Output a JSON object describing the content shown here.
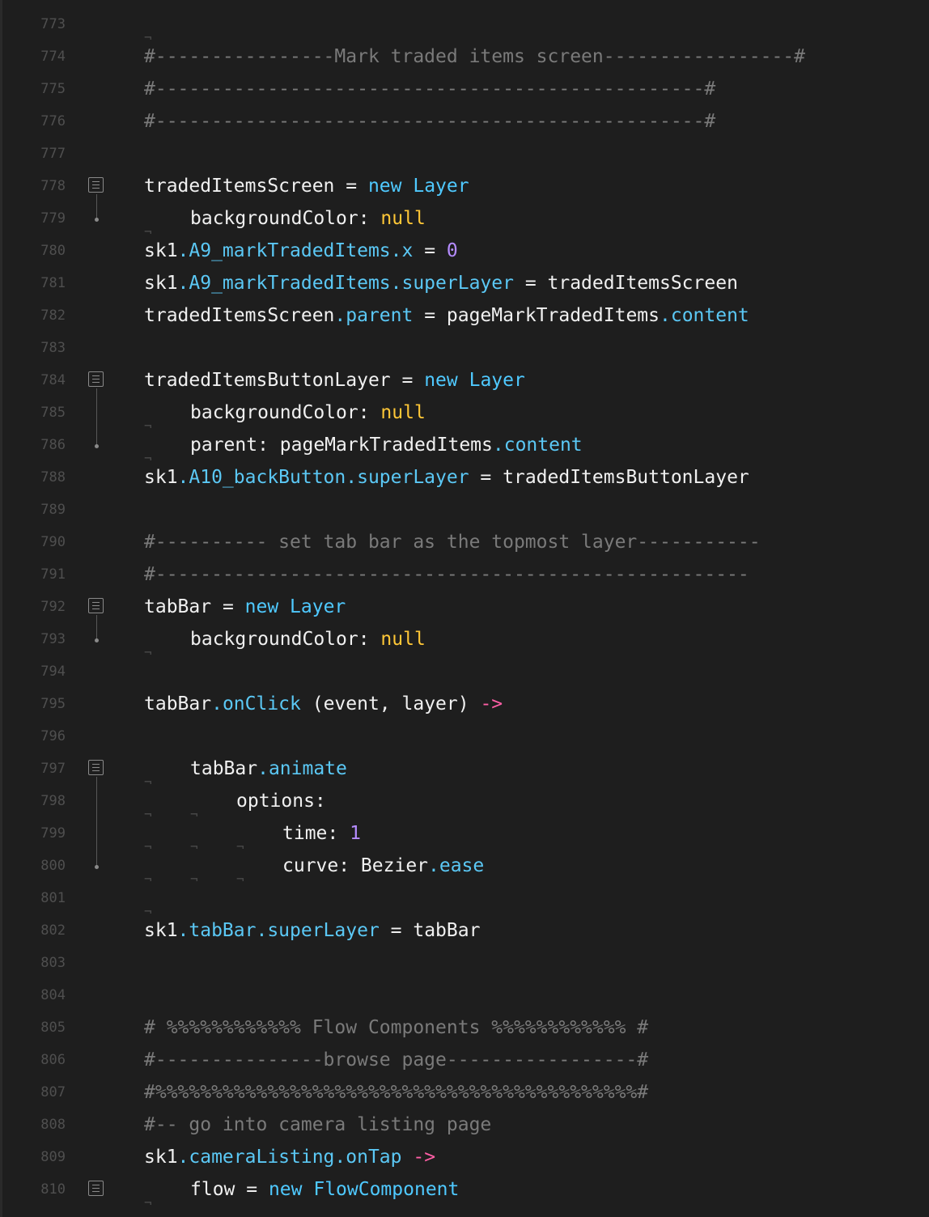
{
  "editor": {
    "lines": [
      {
        "num": "773",
        "indent": 1,
        "tokens": []
      },
      {
        "num": "774",
        "indent": 0,
        "tokens": [
          {
            "c": "comment",
            "t": "#----------------Mark traded items screen-----------------#"
          }
        ]
      },
      {
        "num": "775",
        "indent": 0,
        "tokens": [
          {
            "c": "comment",
            "t": "#-------------------------------------------------#"
          }
        ]
      },
      {
        "num": "776",
        "indent": 0,
        "tokens": [
          {
            "c": "comment",
            "t": "#-------------------------------------------------#"
          }
        ]
      },
      {
        "num": "777",
        "indent": 0,
        "tokens": []
      },
      {
        "num": "778",
        "indent": 0,
        "fold": "start",
        "tokens": [
          {
            "c": "plain",
            "t": "tradedItemsScreen"
          },
          {
            "c": "op",
            "t": " = "
          },
          {
            "c": "kw",
            "t": "new"
          },
          {
            "c": "plain",
            "t": " "
          },
          {
            "c": "class",
            "t": "Layer"
          }
        ]
      },
      {
        "num": "779",
        "indent": 1,
        "fold": "end",
        "tokens": [
          {
            "c": "plain",
            "t": "backgroundColor: "
          },
          {
            "c": "null",
            "t": "null"
          }
        ]
      },
      {
        "num": "780",
        "indent": 0,
        "tokens": [
          {
            "c": "plain",
            "t": "sk1"
          },
          {
            "c": "prop",
            "t": ".A9_markTradedItems.x"
          },
          {
            "c": "op",
            "t": " = "
          },
          {
            "c": "num",
            "t": "0"
          }
        ]
      },
      {
        "num": "781",
        "indent": 0,
        "tokens": [
          {
            "c": "plain",
            "t": "sk1"
          },
          {
            "c": "prop",
            "t": ".A9_markTradedItems.superLayer"
          },
          {
            "c": "op",
            "t": " = "
          },
          {
            "c": "plain",
            "t": "tradedItemsScreen"
          }
        ]
      },
      {
        "num": "782",
        "indent": 0,
        "tokens": [
          {
            "c": "plain",
            "t": "tradedItemsScreen"
          },
          {
            "c": "prop",
            "t": ".parent"
          },
          {
            "c": "op",
            "t": " = "
          },
          {
            "c": "plain",
            "t": "pageMarkTradedItems"
          },
          {
            "c": "prop",
            "t": ".content"
          }
        ]
      },
      {
        "num": "783",
        "indent": 0,
        "tokens": []
      },
      {
        "num": "784",
        "indent": 0,
        "fold": "start",
        "tokens": [
          {
            "c": "plain",
            "t": "tradedItemsButtonLayer"
          },
          {
            "c": "op",
            "t": " = "
          },
          {
            "c": "kw",
            "t": "new"
          },
          {
            "c": "plain",
            "t": " "
          },
          {
            "c": "class",
            "t": "Layer"
          }
        ]
      },
      {
        "num": "785",
        "indent": 1,
        "tokens": [
          {
            "c": "plain",
            "t": "backgroundColor: "
          },
          {
            "c": "null",
            "t": "null"
          }
        ]
      },
      {
        "num": "786",
        "indent": 1,
        "fold": "end",
        "tokens": [
          {
            "c": "plain",
            "t": "parent: pageMarkTradedItems"
          },
          {
            "c": "prop",
            "t": ".content"
          }
        ]
      },
      {
        "num": "788",
        "indent": 0,
        "tokens": [
          {
            "c": "plain",
            "t": "sk1"
          },
          {
            "c": "prop",
            "t": ".A10_backButton.superLayer"
          },
          {
            "c": "op",
            "t": " = "
          },
          {
            "c": "plain",
            "t": "tradedItemsButtonLayer"
          }
        ]
      },
      {
        "num": "789",
        "indent": 0,
        "tokens": []
      },
      {
        "num": "790",
        "indent": 0,
        "tokens": [
          {
            "c": "comment",
            "t": "#---------- set tab bar as the topmost layer-----------"
          }
        ]
      },
      {
        "num": "791",
        "indent": 0,
        "tokens": [
          {
            "c": "comment",
            "t": "#-----------------------------------------------------"
          }
        ]
      },
      {
        "num": "792",
        "indent": 0,
        "fold": "start",
        "tokens": [
          {
            "c": "plain",
            "t": "tabBar"
          },
          {
            "c": "op",
            "t": " = "
          },
          {
            "c": "kw",
            "t": "new"
          },
          {
            "c": "plain",
            "t": " "
          },
          {
            "c": "class",
            "t": "Layer"
          }
        ]
      },
      {
        "num": "793",
        "indent": 1,
        "fold": "end",
        "tokens": [
          {
            "c": "plain",
            "t": "backgroundColor: "
          },
          {
            "c": "null",
            "t": "null"
          }
        ]
      },
      {
        "num": "794",
        "indent": 0,
        "tokens": []
      },
      {
        "num": "795",
        "indent": 0,
        "tokens": [
          {
            "c": "plain",
            "t": "tabBar"
          },
          {
            "c": "prop",
            "t": ".onClick"
          },
          {
            "c": "plain",
            "t": " (event, layer) "
          },
          {
            "c": "arrow",
            "t": "->"
          }
        ]
      },
      {
        "num": "796",
        "indent": 0,
        "tokens": []
      },
      {
        "num": "797",
        "indent": 1,
        "fold": "start",
        "tokens": [
          {
            "c": "plain",
            "t": "tabBar"
          },
          {
            "c": "prop",
            "t": ".animate"
          }
        ]
      },
      {
        "num": "798",
        "indent": 2,
        "tokens": [
          {
            "c": "plain",
            "t": "options:"
          }
        ]
      },
      {
        "num": "799",
        "indent": 3,
        "tokens": [
          {
            "c": "plain",
            "t": "time: "
          },
          {
            "c": "num",
            "t": "1"
          }
        ]
      },
      {
        "num": "800",
        "indent": 3,
        "fold": "end",
        "tokens": [
          {
            "c": "plain",
            "t": "curve: Bezier"
          },
          {
            "c": "prop",
            "t": ".ease"
          }
        ]
      },
      {
        "num": "801",
        "indent": 1,
        "tokens": []
      },
      {
        "num": "802",
        "indent": 0,
        "tokens": [
          {
            "c": "plain",
            "t": "sk1"
          },
          {
            "c": "prop",
            "t": ".tabBar.superLayer"
          },
          {
            "c": "op",
            "t": " = "
          },
          {
            "c": "plain",
            "t": "tabBar"
          }
        ]
      },
      {
        "num": "803",
        "indent": 0,
        "tokens": []
      },
      {
        "num": "804",
        "indent": 0,
        "tokens": []
      },
      {
        "num": "805",
        "indent": 0,
        "tokens": [
          {
            "c": "comment",
            "t": "# %%%%%%%%%%%% Flow Components %%%%%%%%%%%% #"
          }
        ]
      },
      {
        "num": "806",
        "indent": 0,
        "tokens": [
          {
            "c": "comment",
            "t": "#---------------browse page-----------------#"
          }
        ]
      },
      {
        "num": "807",
        "indent": 0,
        "tokens": [
          {
            "c": "comment",
            "t": "#%%%%%%%%%%%%%%%%%%%%%%%%%%%%%%%%%%%%%%%%%%%#"
          }
        ]
      },
      {
        "num": "808",
        "indent": 0,
        "tokens": [
          {
            "c": "comment",
            "t": "#-- go into camera listing page"
          }
        ]
      },
      {
        "num": "809",
        "indent": 0,
        "tokens": [
          {
            "c": "plain",
            "t": "sk1"
          },
          {
            "c": "prop",
            "t": ".cameraListing.onTap"
          },
          {
            "c": "plain",
            "t": " "
          },
          {
            "c": "arrow",
            "t": "->"
          }
        ]
      },
      {
        "num": "810",
        "indent": 1,
        "fold": "start",
        "tokens": [
          {
            "c": "plain",
            "t": "flow"
          },
          {
            "c": "op",
            "t": " = "
          },
          {
            "c": "kw",
            "t": "new"
          },
          {
            "c": "plain",
            "t": " "
          },
          {
            "c": "class",
            "t": "FlowComponent"
          }
        ]
      }
    ]
  }
}
